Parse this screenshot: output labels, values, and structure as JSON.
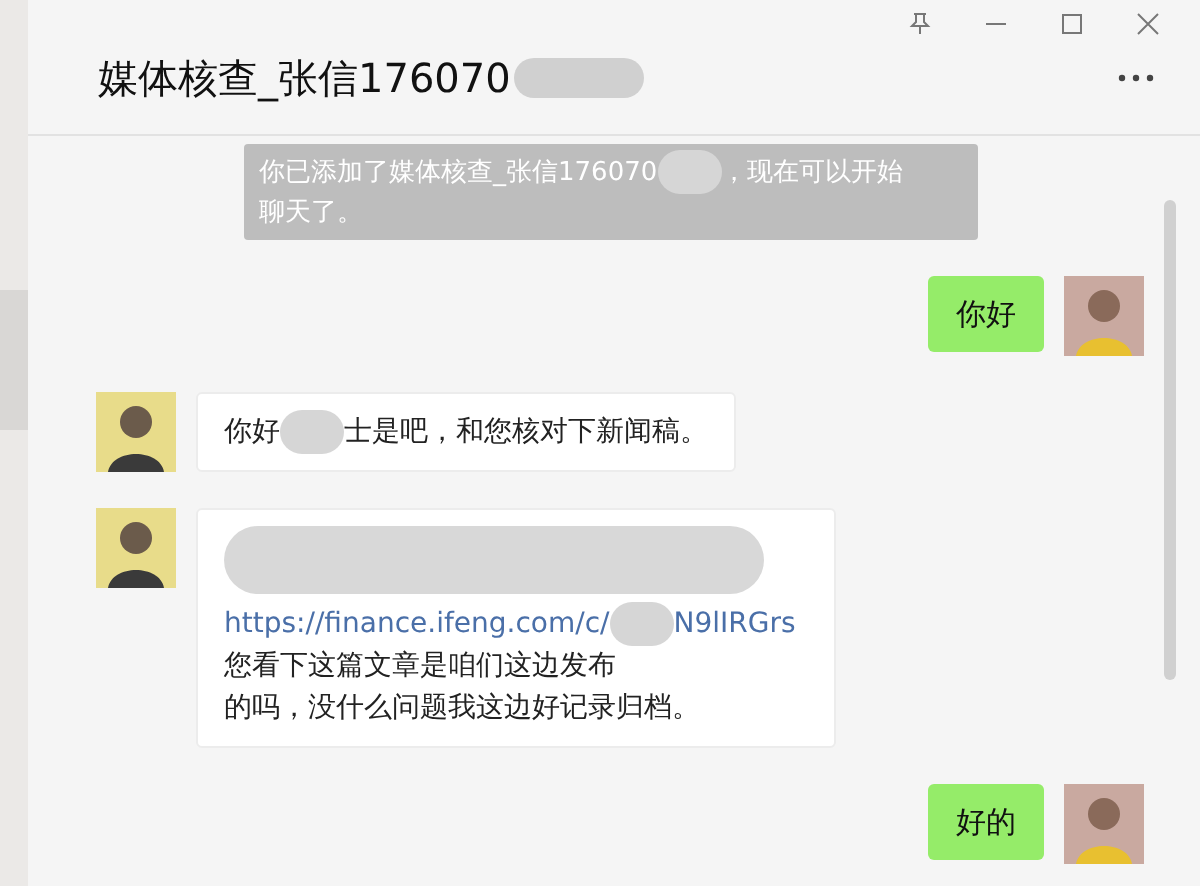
{
  "window": {
    "title": "媒体核查_张信176070"
  },
  "messages": [
    {
      "kind": "system",
      "segments": [
        {
          "kind": "text",
          "text": "你已添加了媒体核查_张信176070"
        },
        {
          "kind": "redacted"
        },
        {
          "kind": "text",
          "text": "，现在可以开始"
        },
        {
          "kind": "text",
          "text": "聊天了。"
        }
      ]
    },
    {
      "kind": "outgoing",
      "segments": [
        {
          "kind": "text",
          "text": "你好"
        }
      ]
    },
    {
      "kind": "incoming",
      "segments": [
        {
          "kind": "text",
          "text": "你好"
        },
        {
          "kind": "redacted"
        },
        {
          "kind": "text",
          "text": "士是吧，和您核对下新闻稿。"
        }
      ]
    },
    {
      "kind": "incoming",
      "segments": [
        {
          "kind": "redacted_block"
        },
        {
          "kind": "link",
          "text": "https://finance.ifeng.com/c/"
        },
        {
          "kind": "redacted"
        },
        {
          "kind": "link",
          "text": "N9"
        },
        {
          "kind": "link",
          "text": "lIRGrs"
        },
        {
          "kind": "text",
          "text": "您看下这篇文章是咱们这边发布"
        },
        {
          "kind": "text",
          "text": "的吗，没什么问题我这边好记录归档。"
        }
      ]
    },
    {
      "kind": "outgoing",
      "segments": [
        {
          "kind": "text",
          "text": "好的"
        }
      ]
    }
  ]
}
